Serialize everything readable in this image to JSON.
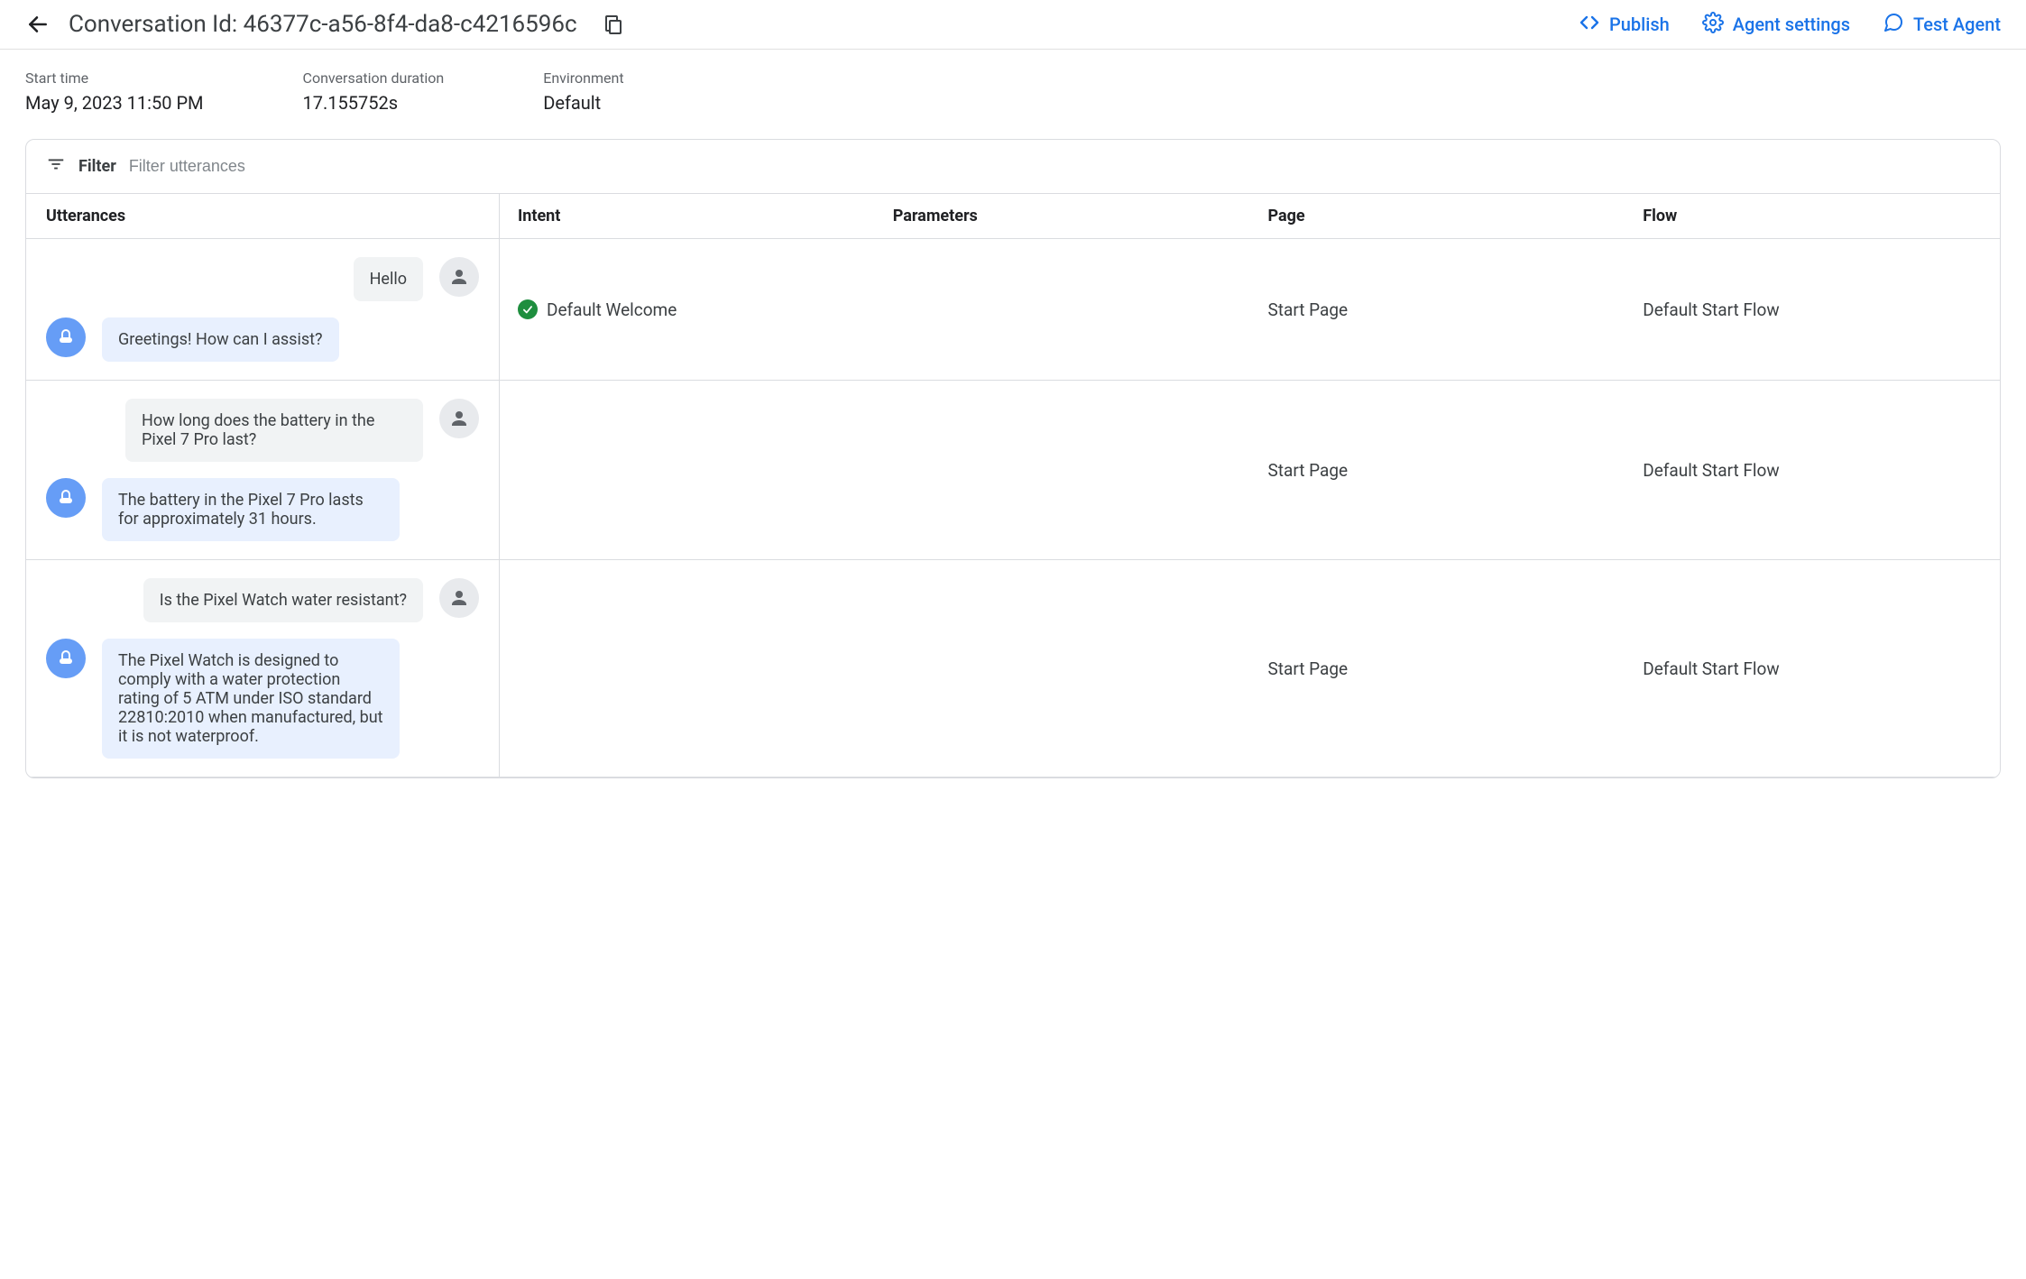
{
  "header": {
    "title": "Conversation Id: 46377c-a56-8f4-da8-c4216596c",
    "actions": {
      "publish": "Publish",
      "agent_settings": "Agent settings",
      "test_agent": "Test Agent"
    }
  },
  "meta": {
    "start_time_label": "Start time",
    "start_time_value": "May 9, 2023 11:50 PM",
    "duration_label": "Conversation duration",
    "duration_value": "17.155752s",
    "environment_label": "Environment",
    "environment_value": "Default"
  },
  "filter": {
    "label": "Filter",
    "placeholder": "Filter utterances"
  },
  "columns": {
    "utterances": "Utterances",
    "intent": "Intent",
    "parameters": "Parameters",
    "page": "Page",
    "flow": "Flow"
  },
  "turns": [
    {
      "user": "Hello",
      "bot": "Greetings! How can I assist?",
      "intent": "Default Welcome",
      "intent_matched": true,
      "parameters": "",
      "page": "Start Page",
      "flow": "Default Start Flow"
    },
    {
      "user": "How long does the battery in the Pixel 7 Pro last?",
      "bot": "The battery in the Pixel 7 Pro lasts for approximately 31 hours.",
      "intent": "",
      "intent_matched": false,
      "parameters": "",
      "page": "Start Page",
      "flow": "Default Start Flow"
    },
    {
      "user": "Is the Pixel Watch water resistant?",
      "bot": "The Pixel Watch is designed to comply with a water protection rating of 5 ATM under ISO standard 22810:2010 when manufactured, but it is not waterproof.",
      "intent": "",
      "intent_matched": false,
      "parameters": "",
      "page": "Start Page",
      "flow": "Default Start Flow"
    }
  ]
}
